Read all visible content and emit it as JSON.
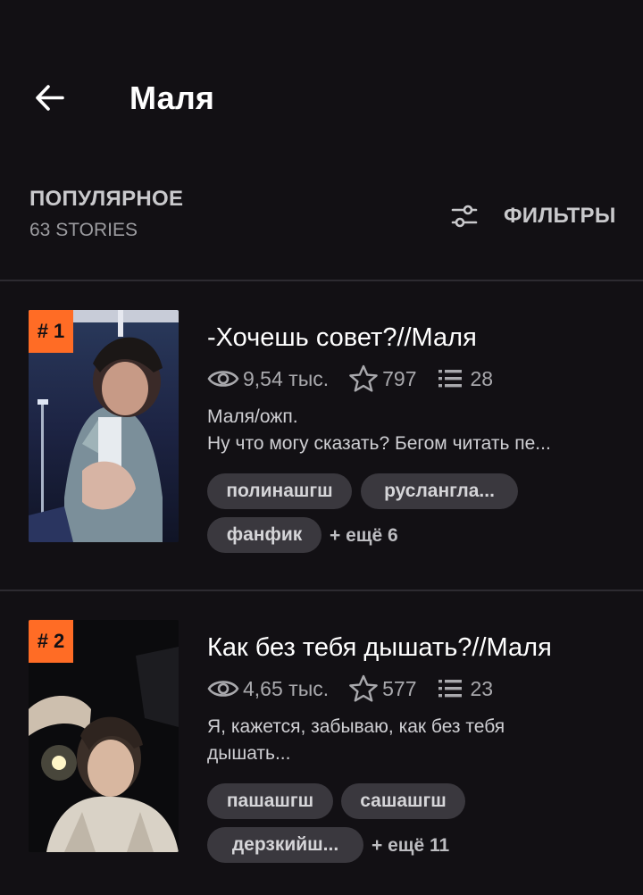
{
  "header": {
    "title": "Маля"
  },
  "sort": {
    "label": "ПОПУЛЯРНОЕ",
    "count": "63 STORIES",
    "filters_label": "ФИЛЬТРЫ"
  },
  "colors": {
    "background": "#121014",
    "accent": "#ff6c25",
    "tag_bg": "#3a383e",
    "divider": "#2d2b31"
  },
  "stories": [
    {
      "rank": "# 1",
      "title": "-Хочешь совет?//Маля",
      "views": "9,54 тыс.",
      "votes": "797",
      "parts": "28",
      "desc_line1": "Маля/ожп.",
      "desc_line2": "Ну что могу сказать? Бегом читать пе...",
      "tags": [
        "полинашгш",
        "русланглa...",
        "фанфик"
      ],
      "more": "+ ещё 6"
    },
    {
      "rank": "# 2",
      "title": "Как без тебя дышать?//Маля",
      "views": "4,65 тыс.",
      "votes": "577",
      "parts": "23",
      "desc_line1": "Я, кажется, забываю, как без тебя",
      "desc_line2": "дышать...",
      "tags": [
        "пашашгш",
        "сашашгш",
        "дерзкийш..."
      ],
      "more": "+ ещё 11"
    }
  ]
}
